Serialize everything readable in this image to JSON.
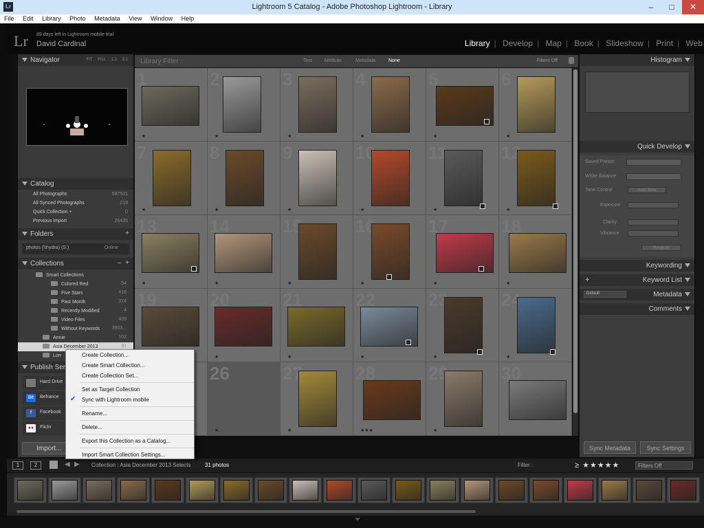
{
  "window": {
    "title": "Lightroom 5 Catalog - Adobe Photoshop Lightroom - Library",
    "minimize": "–",
    "maximize": "□",
    "close": "✕",
    "app_icon": "Lr"
  },
  "menu": [
    "File",
    "Edit",
    "Library",
    "Photo",
    "Metadata",
    "View",
    "Window",
    "Help"
  ],
  "identity": {
    "logo": "Lr",
    "trial": "89 days left in Lightroom mobile trial",
    "user": "David Cardinal"
  },
  "modules": {
    "library": "Library",
    "develop": "Develop",
    "map": "Map",
    "book": "Book",
    "slideshow": "Slideshow",
    "print": "Print",
    "web": "Web"
  },
  "navigator": {
    "title": "Navigator",
    "zoom_fit": "FIT",
    "zoom_fill": "FILL",
    "zoom_1": "1:1",
    "zoom_3": "3:1"
  },
  "catalog": {
    "title": "Catalog",
    "rows": [
      {
        "label": "All Photographs",
        "count": "597501"
      },
      {
        "label": "All Synced Photographs",
        "count": "219"
      },
      {
        "label": "Quick Collection +",
        "count": "0"
      },
      {
        "label": "Previous Import",
        "count": "26435"
      }
    ]
  },
  "folders": {
    "title": "Folders",
    "add": "+",
    "row": "photos (\\\\hydra) (S:)",
    "status": "Online"
  },
  "collections": {
    "title": "Collections",
    "minus": "–",
    "add": "+",
    "smart_set": "Smart Collections",
    "smart_items": [
      {
        "label": "Colored Red",
        "count": "54"
      },
      {
        "label": "Five Stars",
        "count": "416"
      },
      {
        "label": "Past Month",
        "count": "374"
      },
      {
        "label": "Recently Modified",
        "count": "4"
      },
      {
        "label": "Video Files",
        "count": "409"
      },
      {
        "label": "Without Keywords",
        "count": "3903..."
      }
    ],
    "annie": {
      "label": "Annie",
      "count": "102"
    },
    "asia": {
      "label": "Asia December 2013",
      "count": "31"
    },
    "lorr": {
      "label": "Lorr"
    }
  },
  "publish": {
    "title": "Publish Ser",
    "rows": [
      {
        "icon": "",
        "label": "Hard Drive"
      },
      {
        "icon": "Bē",
        "label": "Behance"
      },
      {
        "icon": "f",
        "label": "Facebook"
      },
      {
        "icon": "●●",
        "label": "Flickr"
      }
    ]
  },
  "import_button": "Import...",
  "filter_bar": {
    "title": "Library Filter :",
    "text": "Text",
    "attribute": "Attribute",
    "metadata": "Metadata",
    "none": "None",
    "filters_off": "Filters Off"
  },
  "grid": {
    "cells": [
      {
        "num": "1",
        "stars": "★"
      },
      {
        "num": "2",
        "stars": "★"
      },
      {
        "num": "3",
        "stars": "★"
      },
      {
        "num": "4",
        "stars": "★"
      },
      {
        "num": "5",
        "stars": "★"
      },
      {
        "num": "6",
        "stars": "★"
      },
      {
        "num": "7",
        "stars": "★"
      },
      {
        "num": "8",
        "stars": "★"
      },
      {
        "num": "9",
        "stars": "★"
      },
      {
        "num": "10",
        "stars": "★"
      },
      {
        "num": "11",
        "stars": "★"
      },
      {
        "num": "12",
        "stars": "★"
      },
      {
        "num": "13",
        "stars": "★"
      },
      {
        "num": "14",
        "stars": "★"
      },
      {
        "num": "15",
        "stars": "★"
      },
      {
        "num": "16",
        "stars": "★"
      },
      {
        "num": "17",
        "stars": "★"
      },
      {
        "num": "18",
        "stars": "★"
      },
      {
        "num": "19",
        "stars": "★"
      },
      {
        "num": "20",
        "stars": "★"
      },
      {
        "num": "21",
        "stars": "★"
      },
      {
        "num": "22",
        "stars": "★"
      },
      {
        "num": "23",
        "stars": "★"
      },
      {
        "num": "24",
        "stars": "★"
      },
      {
        "num": "25",
        "stars": "★"
      },
      {
        "num": "26",
        "stars": "★"
      },
      {
        "num": "27",
        "stars": "★"
      },
      {
        "num": "28",
        "stars": "★★★"
      },
      {
        "num": "29",
        "stars": "★"
      },
      {
        "num": "30",
        "stars": ""
      }
    ]
  },
  "context_menu": {
    "create_collection": "Create Collection...",
    "create_smart_collection": "Create Smart Collection...",
    "create_collection_set": "Create Collection Set...",
    "set_target": "Set as Target Collection",
    "sync_mobile": "Sync with Lightroom mobile",
    "rename": "Rename...",
    "delete": "Delete...",
    "export_catalog": "Export this Collection as a Catalog...",
    "import_smart": "Import Smart Collection Settings..."
  },
  "right_panel": {
    "histogram": "Histogram",
    "quick_develop": "Quick Develop",
    "saved_preset": "Saved Preset",
    "white_balance": "White Balance",
    "tone_control": "Tone Control",
    "auto_tone": "Auto Tone",
    "exposure": "Exposure",
    "clarity": "Clarity",
    "vibrance": "Vibrance",
    "reset_all": "Reset All",
    "keywording": "Keywording",
    "keyword_list": "Keyword List",
    "metadata": "Metadata",
    "metadata_preset": "Default",
    "comments": "Comments",
    "sync_metadata": "Sync Metadata",
    "sync_settings": "Sync Settings"
  },
  "toolbar": {
    "view1": "1",
    "view2": "2",
    "source": "Collection : Asia December 2013 Selects",
    "count": "31 photos",
    "filter_label": "Filter :",
    "stars": "≥ ★★★★★",
    "filters_off": "Filters Off"
  },
  "colors": {
    "accent": "#ffffff",
    "panel": "#3c3c3c",
    "grid": "#6d6d6d",
    "menu_check": "#1e56b8"
  }
}
